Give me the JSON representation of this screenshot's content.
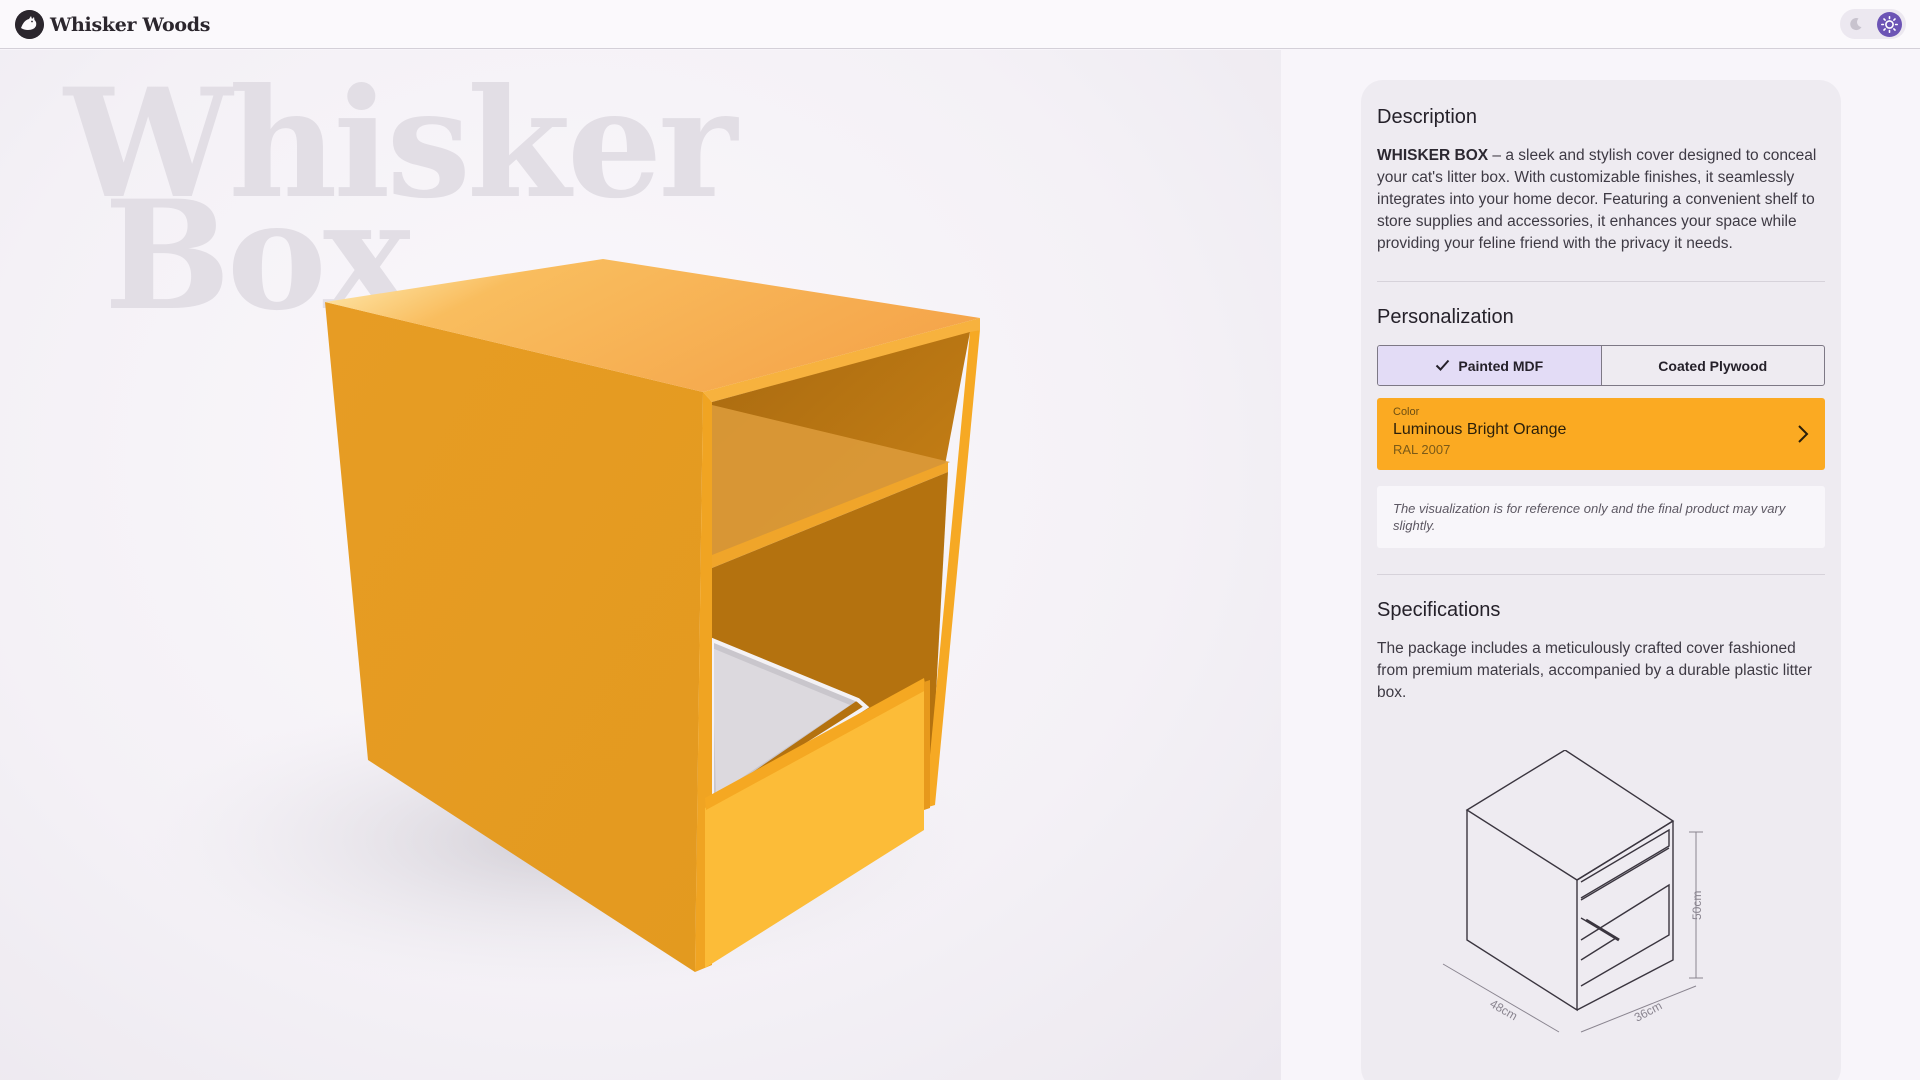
{
  "header": {
    "brand": "Whisker Woods",
    "logo_icon": "cat-silhouette-icon",
    "theme_light_icon": "moon-icon",
    "theme_dark_icon": "sun-icon"
  },
  "stage": {
    "title_line1": "Whisker",
    "title_line2": "Box",
    "product_color": "#f5a623"
  },
  "description": {
    "title": "Description",
    "product_name": "WHISKER BOX",
    "body": " – a sleek and stylish cover designed to conceal your cat's litter box. With customizable finishes, it seamlessly integrates into your home decor. Featuring a convenient shelf to store supplies and accessories, it enhances your space while providing your feline friend with the privacy it needs."
  },
  "personalization": {
    "title": "Personalization",
    "materials": [
      "Painted MDF",
      "Coated Plywood"
    ],
    "selected_material": "Painted MDF",
    "color": {
      "label": "Color",
      "name": "Luminous Bright Orange",
      "code": "RAL 2007",
      "swatch": "#fbaa22"
    },
    "note": "The visualization is for reference only and the final product may vary slightly."
  },
  "specifications": {
    "title": "Specifications",
    "body": "The package includes a meticulously crafted cover fashioned from premium materials, accompanied by a durable plastic litter box.",
    "dimensions": {
      "height": "50cm",
      "width": "48cm",
      "depth": "36cm"
    }
  },
  "colors": {
    "accent": "#6c54b5",
    "segment_active": "#e3dcf6"
  }
}
